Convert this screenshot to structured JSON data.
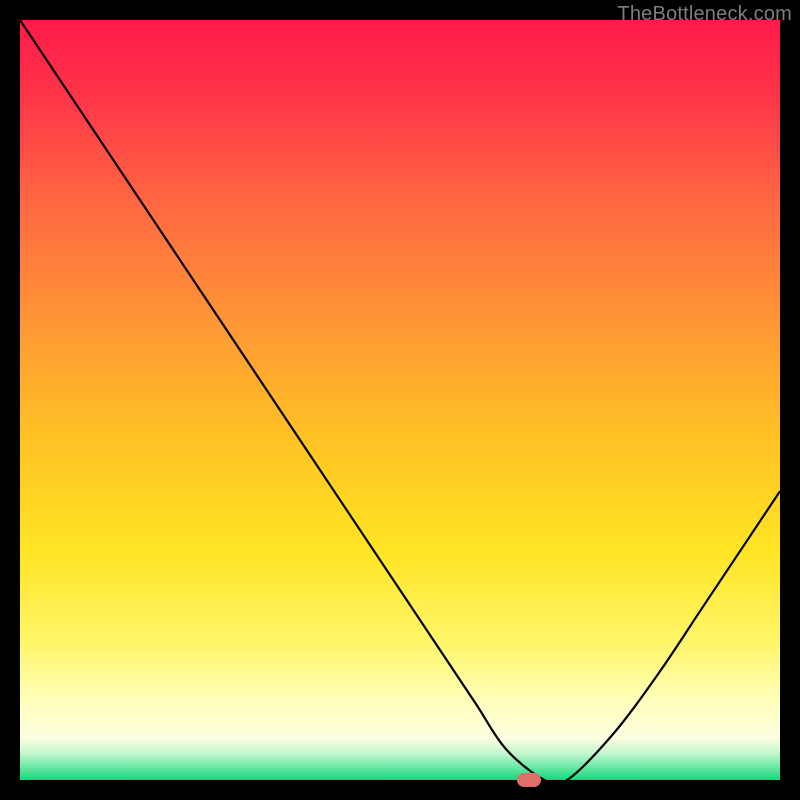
{
  "watermark": "TheBottleneck.com",
  "chart_data": {
    "type": "line",
    "title": "",
    "xlabel": "",
    "ylabel": "",
    "xlim": [
      0,
      100
    ],
    "ylim": [
      0,
      100
    ],
    "grid": false,
    "gradient_stops": [
      {
        "pos": 0.0,
        "color": "#ff1a4a"
      },
      {
        "pos": 0.1,
        "color": "#ff3549"
      },
      {
        "pos": 0.25,
        "color": "#ff6a41"
      },
      {
        "pos": 0.4,
        "color": "#ff9735"
      },
      {
        "pos": 0.55,
        "color": "#ffc224"
      },
      {
        "pos": 0.7,
        "color": "#ffe524"
      },
      {
        "pos": 0.82,
        "color": "#fff66a"
      },
      {
        "pos": 0.9,
        "color": "#ffffbf"
      },
      {
        "pos": 0.945,
        "color": "#fdfde0"
      },
      {
        "pos": 0.965,
        "color": "#c2f7cf"
      },
      {
        "pos": 0.982,
        "color": "#6fe9a6"
      },
      {
        "pos": 1.0,
        "color": "#13d77d"
      }
    ],
    "series": [
      {
        "name": "bottleneck-curve",
        "color": "#000000",
        "x": [
          0,
          4,
          8,
          12,
          16,
          20,
          24,
          30,
          36,
          42,
          48,
          52,
          56,
          60,
          64,
          69,
          72,
          78,
          84,
          90,
          96,
          100
        ],
        "y": [
          100,
          94,
          88,
          82,
          76,
          70,
          64,
          55,
          46,
          37,
          28,
          22,
          16,
          10,
          4,
          0,
          0,
          6,
          14,
          23,
          32,
          38
        ]
      }
    ],
    "marker": {
      "x": 67,
      "y": 0,
      "color": "#e06f6a"
    }
  }
}
